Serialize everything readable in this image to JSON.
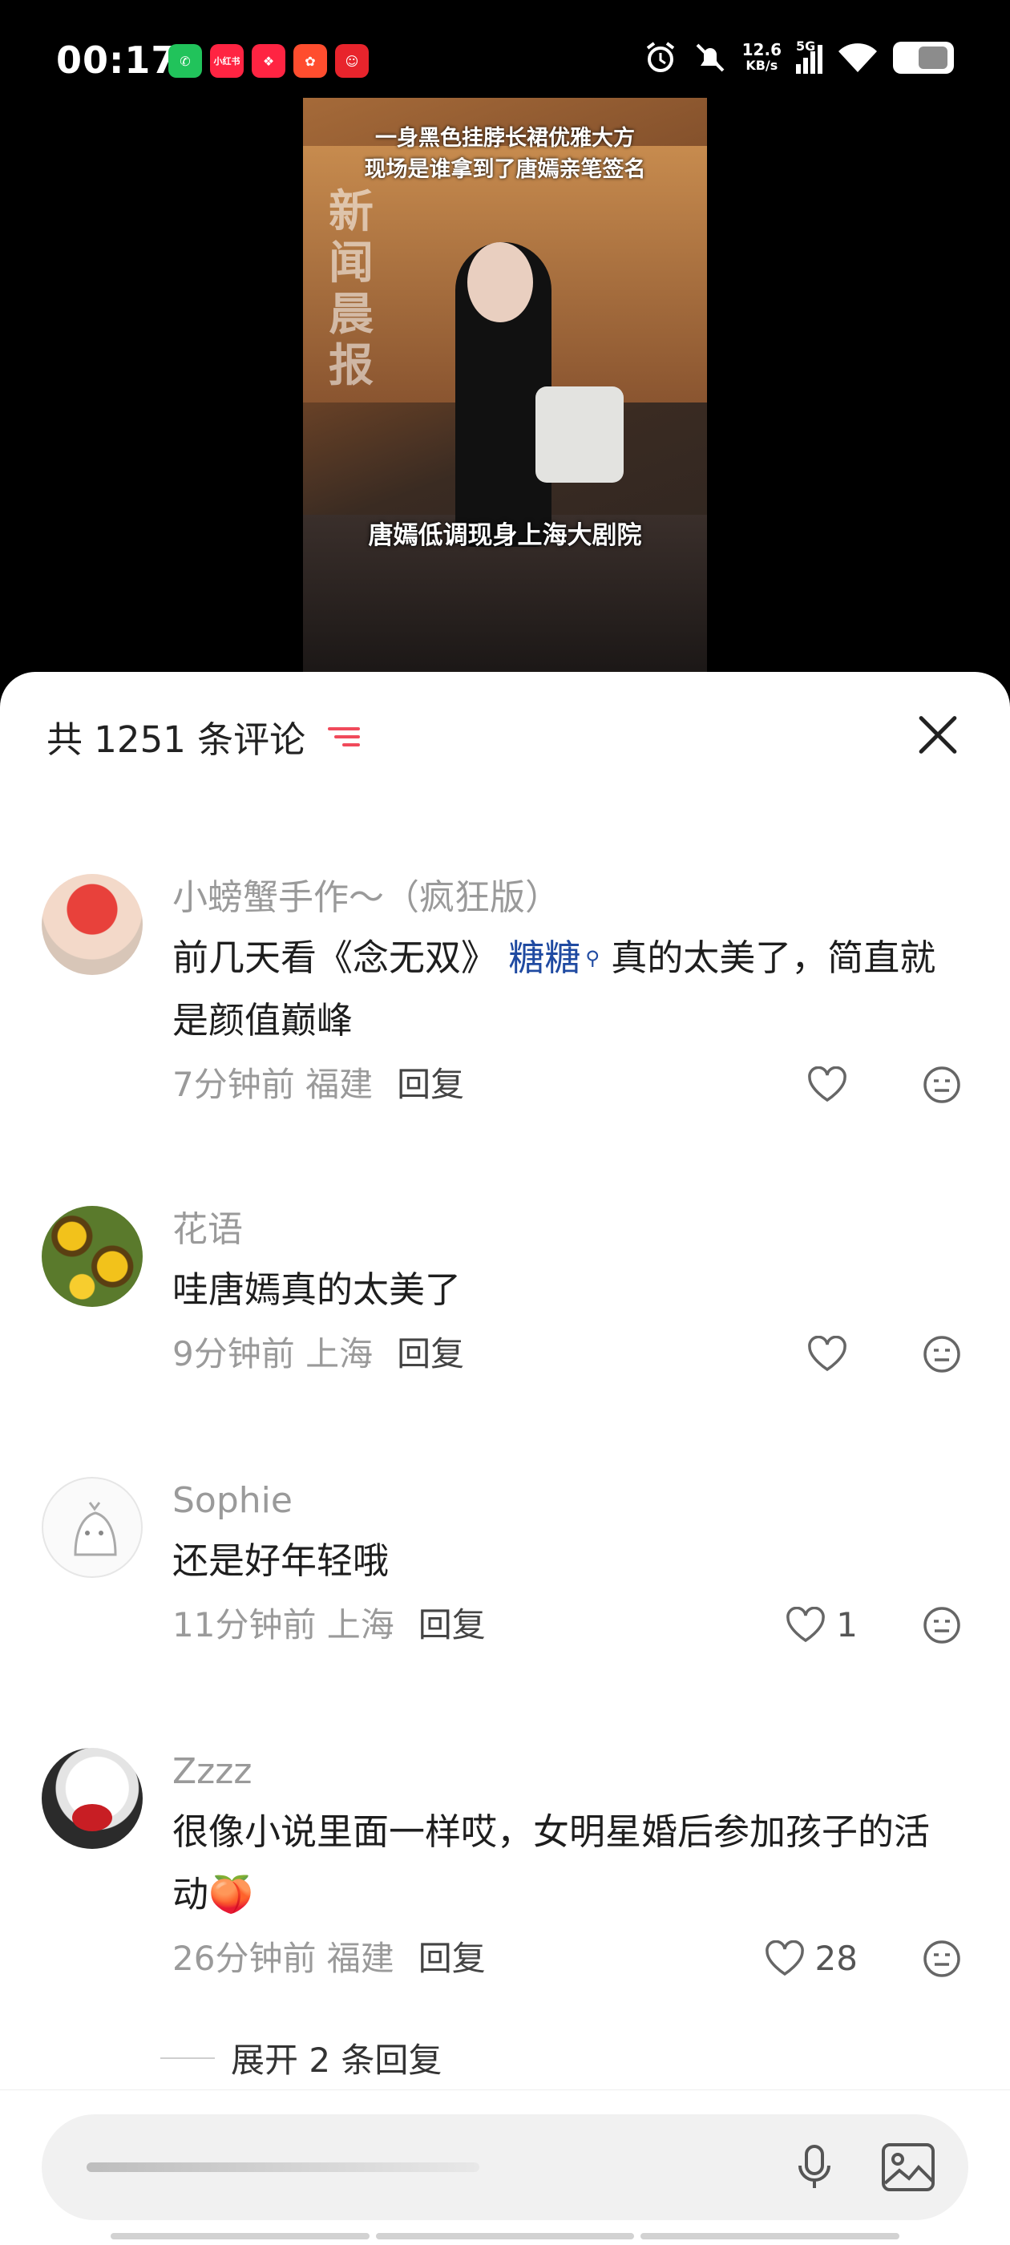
{
  "status_bar": {
    "time": "00:17",
    "net_speed_value": "12.6",
    "net_speed_unit": "KB/s",
    "signal": "5G",
    "apps": [
      {
        "name": "wechat",
        "color": "#21c35b",
        "label": "✆"
      },
      {
        "name": "xiaohongshu",
        "color": "#ff2442",
        "label": "小红书"
      },
      {
        "name": "app-red-1",
        "color": "#ff2442",
        "label": "❖"
      },
      {
        "name": "app-red-2",
        "color": "#ff4d2e",
        "label": "✿"
      },
      {
        "name": "app-red-3",
        "color": "#e8242c",
        "label": "☺"
      }
    ]
  },
  "video": {
    "top_text_line1": "一身黑色挂脖长裙优雅大方",
    "top_text_line2": "现场是谁拿到了唐嫣亲笔签名",
    "watermark": "新闻晨报",
    "caption": "唐嫣低调现身上海大剧院"
  },
  "comments_panel": {
    "count_label": "共 1251 条评论",
    "colors": {
      "accent": "#f04a5b",
      "tag": "#1f4aa1"
    },
    "comments": [
      {
        "user": "小螃蟹手作～（疯狂版）",
        "text_before": "前几天看《念无双》",
        "tag": "糖糖",
        "text_after": "真的太美了，简直就是颜值巅峰",
        "time_loc": "7分钟前 福建",
        "reply": "回复",
        "likes": ""
      },
      {
        "user": "花语",
        "text": "哇唐嫣真的太美了",
        "time_loc": "9分钟前 上海",
        "reply": "回复",
        "likes": ""
      },
      {
        "user": "Sophie",
        "text": "还是好年轻哦",
        "time_loc": "11分钟前 上海",
        "reply": "回复",
        "likes": "1"
      },
      {
        "user": "Zzzz",
        "text": "很像小说里面一样哎，女明星婚后参加孩子的活动",
        "emoji": "🍑",
        "time_loc": "26分钟前 福建",
        "reply": "回复",
        "likes": "28"
      }
    ],
    "expand_replies": "展开 2 条回复"
  }
}
